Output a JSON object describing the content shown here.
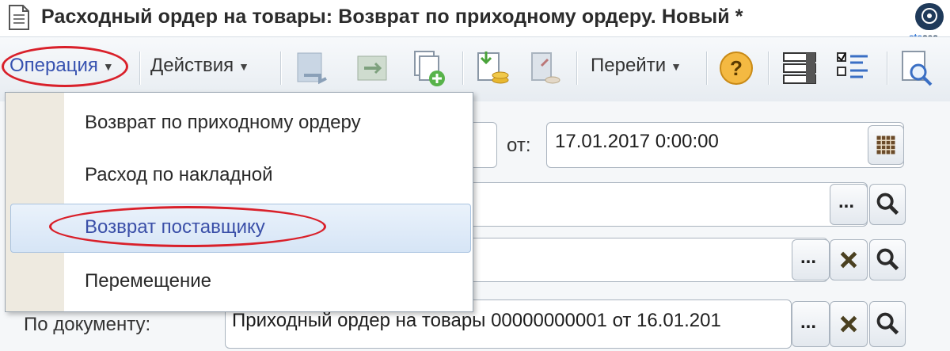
{
  "window": {
    "title": "Расходный ордер на товары: Возврат по приходному ордеру. Новый *"
  },
  "logo": {
    "brand_a": "sto",
    "brand_b": "seo"
  },
  "toolbar": {
    "operation_label": "Операция",
    "actions_label": "Действия",
    "goto_label": "Перейти",
    "help_glyph": "?"
  },
  "operation_menu": {
    "items": [
      {
        "label": "Возврат по приходному ордеру"
      },
      {
        "label": "Расход по накладной"
      },
      {
        "label": "Возврат поставщику",
        "selected": true
      },
      {
        "label": "Перемещение"
      }
    ]
  },
  "form": {
    "date_label": "от:",
    "date_value": "17.01.2017  0:00:00",
    "select_button": "...",
    "by_document_label": "По документу:",
    "by_document_value": "Приходный ордер на товары 00000000001 от 16.01.201"
  },
  "annotations": {
    "highlight_color": "#d9202a"
  }
}
